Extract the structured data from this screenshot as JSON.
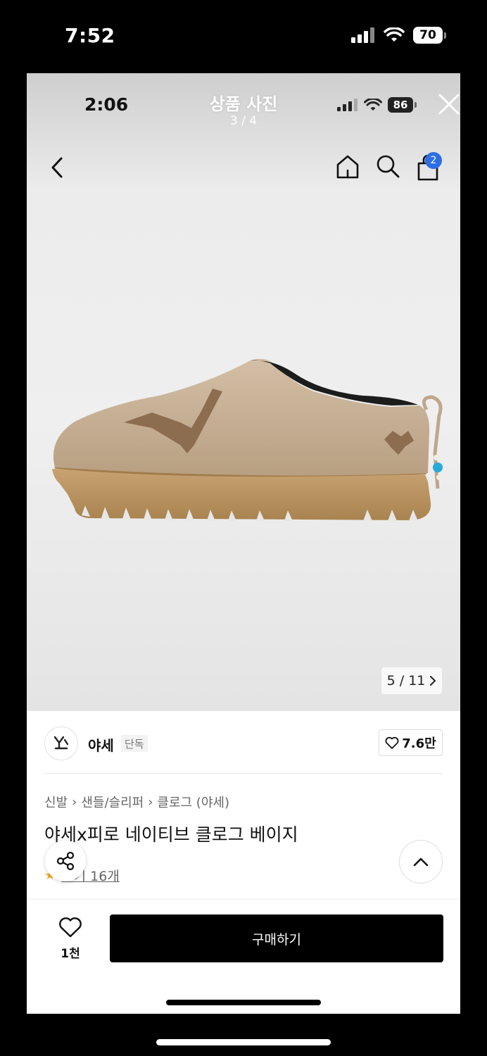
{
  "device": {
    "time": "7:52",
    "battery": "70"
  },
  "viewer": {
    "title": "상품 사진",
    "counter": "3 / 4",
    "inner_time": "2:06",
    "inner_battery": "86"
  },
  "nav": {
    "cart_badge": "2"
  },
  "gallery": {
    "pager": "5 / 11"
  },
  "brand": {
    "logo_text": "yase",
    "name": "야세",
    "tag": "단독",
    "likes": "7.6만"
  },
  "product": {
    "breadcrumb": [
      "신발",
      "샌들/슬리퍼",
      "클로그 (야세)"
    ],
    "name": "야세x피로 네이티브 클로그 베이지",
    "review_link": "후기 16개"
  },
  "bottom": {
    "wish_count": "1천",
    "buy_label": "구매하기"
  },
  "colors": {
    "badge": "#2d6de6",
    "buy_button": "#000000",
    "shoe": "#c9b399"
  }
}
